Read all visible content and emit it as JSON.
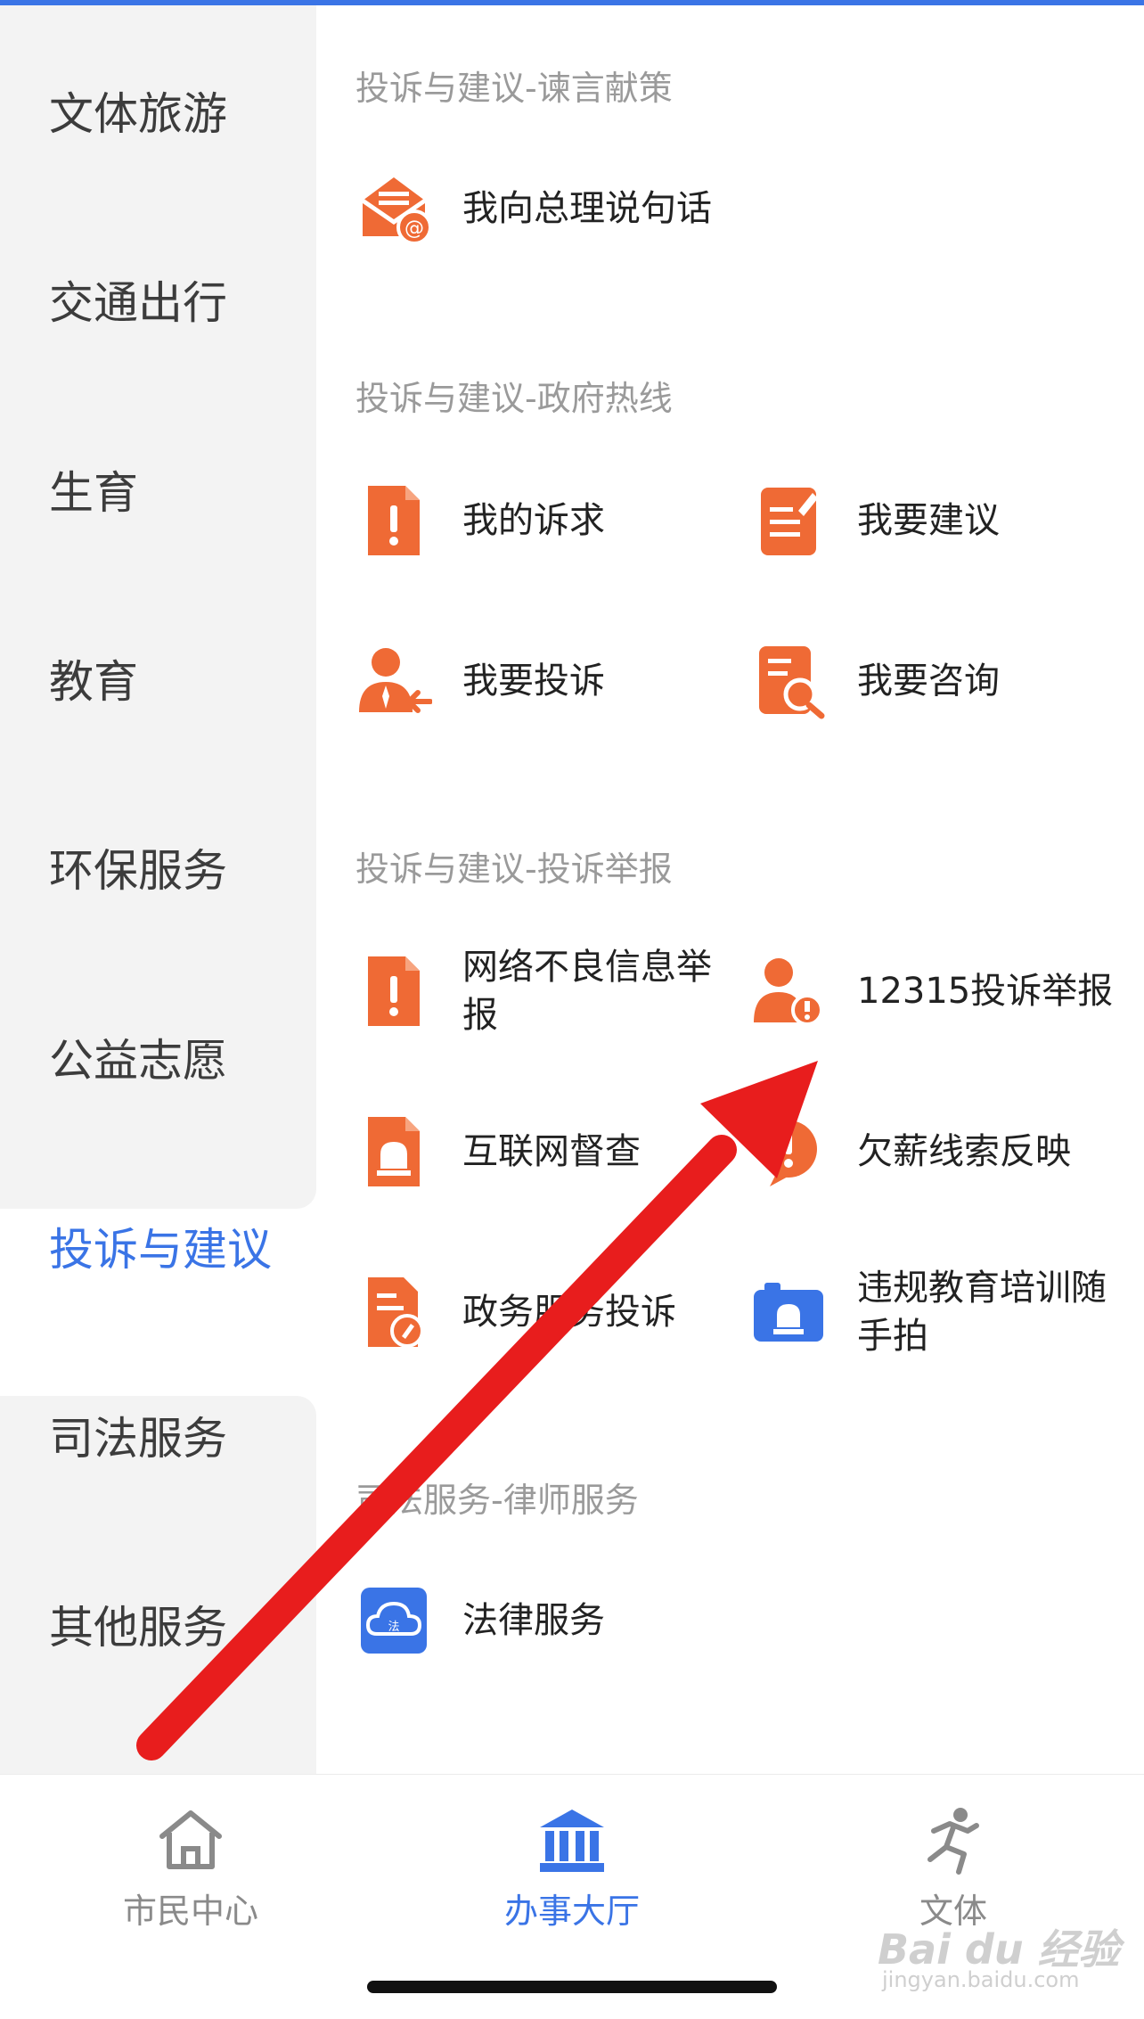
{
  "sidebar": {
    "items": [
      {
        "label": "文体旅游"
      },
      {
        "label": "交通出行"
      },
      {
        "label": "生育"
      },
      {
        "label": "教育"
      },
      {
        "label": "环保服务"
      },
      {
        "label": "公益志愿"
      },
      {
        "label": "投诉与建议"
      },
      {
        "label": "司法服务"
      },
      {
        "label": "其他服务"
      }
    ],
    "active_index": 6
  },
  "sections": [
    {
      "title": "投诉与建议-谏言献策",
      "items": [
        {
          "label": "我向总理说句话",
          "icon": "envelope-at-icon"
        }
      ]
    },
    {
      "title": "投诉与建议-政府热线",
      "items": [
        {
          "label": "我的诉求",
          "icon": "document-exclamation-icon"
        },
        {
          "label": "我要建议",
          "icon": "document-pen-icon"
        },
        {
          "label": "我要投诉",
          "icon": "person-arrow-icon"
        },
        {
          "label": "我要咨询",
          "icon": "document-search-icon"
        }
      ]
    },
    {
      "title": "投诉与建议-投诉举报",
      "items": [
        {
          "label": "网络不良信息举报",
          "icon": "document-exclamation-icon"
        },
        {
          "label": "12315投诉举报",
          "icon": "person-alert-icon"
        },
        {
          "label": "互联网督查",
          "icon": "document-alarm-icon"
        },
        {
          "label": "欠薪线索反映",
          "icon": "alert-bubble-icon"
        },
        {
          "label": "政务服务投诉",
          "icon": "document-edit-icon"
        },
        {
          "label": "违规教育培训随手拍",
          "icon": "camera-alarm-icon"
        }
      ]
    },
    {
      "title": "司法服务-律师服务",
      "items": [
        {
          "label": "法律服务",
          "icon": "cloud-law-icon"
        }
      ]
    }
  ],
  "tabbar": {
    "tabs": [
      {
        "label": "市民中心",
        "icon": "home-icon"
      },
      {
        "label": "办事大厅",
        "icon": "bank-building-icon"
      },
      {
        "label": "文体",
        "icon": "running-person-icon"
      }
    ],
    "active_index": 1
  },
  "watermark": {
    "brand": "Bai du 经验",
    "url": "jingyan.baidu.com"
  },
  "colors": {
    "accent": "#3a74e6",
    "icon_orange": "#ef6a35",
    "icon_blue": "#3a74e6",
    "annotation_arrow": "#e81d1d"
  }
}
